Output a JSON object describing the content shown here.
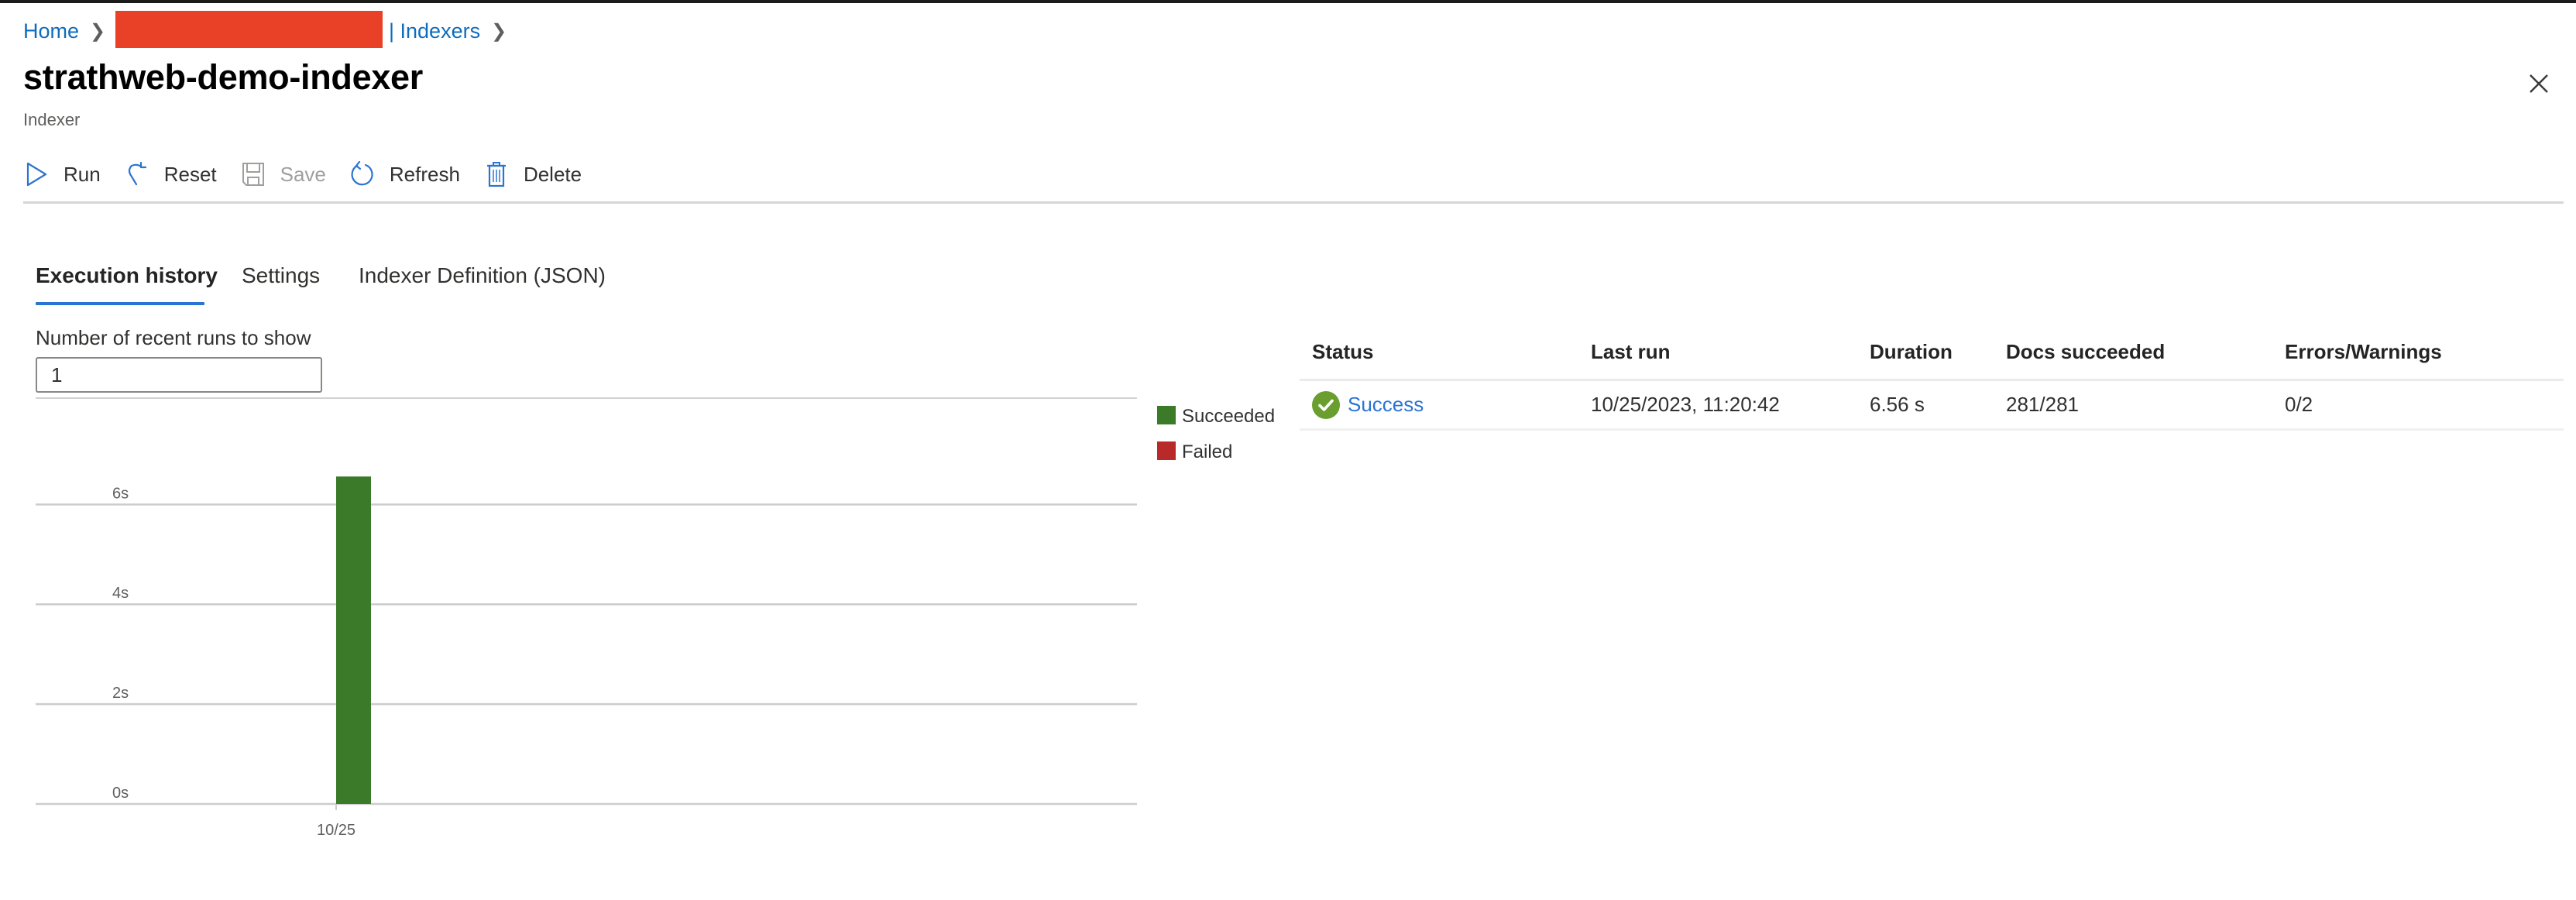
{
  "breadcrumb": {
    "home": "Home",
    "redacted_color": "#e84128",
    "indexers": "| Indexers"
  },
  "header": {
    "title": "strathweb-demo-indexer",
    "subtitle": "Indexer",
    "close_icon": "close-icon"
  },
  "toolbar": {
    "items": [
      {
        "label": "Run",
        "icon": "play-icon",
        "disabled": false
      },
      {
        "label": "Reset",
        "icon": "reset-icon",
        "disabled": false
      },
      {
        "label": "Save",
        "icon": "save-icon",
        "disabled": true
      },
      {
        "label": "Refresh",
        "icon": "refresh-icon",
        "disabled": false
      },
      {
        "label": "Delete",
        "icon": "delete-icon",
        "disabled": false
      }
    ]
  },
  "tabs": [
    {
      "label": "Execution history",
      "active": true
    },
    {
      "label": "Settings",
      "active": false
    },
    {
      "label": "Indexer Definition (JSON)",
      "active": false
    }
  ],
  "runs_filter": {
    "label": "Number of recent runs to show",
    "value": "1"
  },
  "colors": {
    "accent": "#2b74d3",
    "succeeded": "#3a7a28",
    "failed": "#b82a2a",
    "success_icon": "#6a9e2f"
  },
  "chart_data": {
    "type": "bar",
    "title": "",
    "xlabel": "",
    "ylabel": "",
    "categories": [
      "10/25"
    ],
    "series": [
      {
        "name": "Succeeded",
        "color": "#3a7a28",
        "values": [
          6.56
        ]
      },
      {
        "name": "Failed",
        "color": "#b82a2a",
        "values": [
          0
        ]
      }
    ],
    "yticks": [
      {
        "value": 0,
        "label": "0s"
      },
      {
        "value": 2,
        "label": "2s"
      },
      {
        "value": 4,
        "label": "4s"
      },
      {
        "value": 6,
        "label": "6s"
      }
    ],
    "ylim": [
      0,
      7.2
    ],
    "grid": true,
    "legend": "top-right"
  },
  "table": {
    "columns": [
      "Status",
      "Last run",
      "Duration",
      "Docs succeeded",
      "Errors/Warnings"
    ],
    "rows": [
      {
        "status": "Success",
        "status_icon": "check-circle-icon",
        "last_run": "10/25/2023, 11:20:42",
        "duration": "6.56 s",
        "docs_succeeded": "281/281",
        "errors_warnings": "0/2"
      }
    ]
  }
}
